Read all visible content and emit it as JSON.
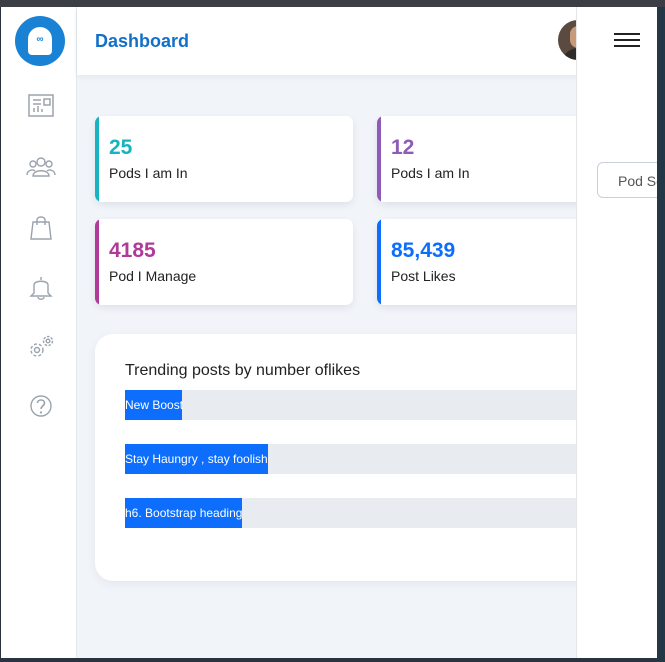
{
  "header": {
    "title": "Dashboard"
  },
  "stats": [
    {
      "value": "25",
      "label": "Pods I am In",
      "color": "#17b3c1"
    },
    {
      "value": "12",
      "label": "Pods I am In",
      "color": "#8e5cb8"
    },
    {
      "value": "4185",
      "label": "Pod I Manage",
      "color": "#b03a9a"
    },
    {
      "value": "85,439",
      "label": "Post Likes",
      "color": "#0d6efd"
    }
  ],
  "trending": {
    "title": "Trending posts by number oflikes",
    "items": [
      {
        "label": "New Boost",
        "fraction": 0.1
      },
      {
        "label": "Stay Haungry , stay foolish",
        "fraction": 0.25
      },
      {
        "label": "h6. Bootstrap heading",
        "fraction": 0.205
      }
    ]
  },
  "drawer": {
    "search_label": "Pod Search"
  },
  "sidebar": {
    "items": [
      "dashboard-icon",
      "users-icon",
      "shopping-bag-icon",
      "bell-icon",
      "settings-icon",
      "help-icon"
    ]
  },
  "colors": {
    "brand": "#1270c9",
    "accent": "#0d6efd",
    "logo": "#1a82d4"
  }
}
